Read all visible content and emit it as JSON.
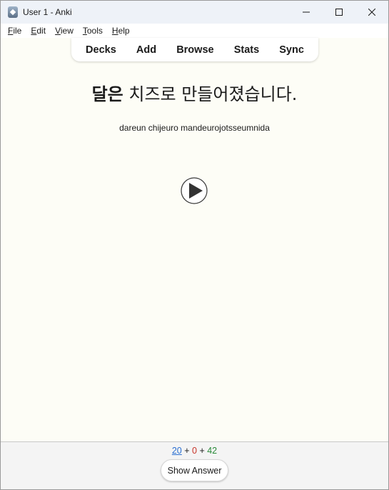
{
  "window": {
    "title": "User 1 - Anki",
    "app_icon": "anki-icon"
  },
  "menu": {
    "items": [
      {
        "label": "File",
        "mnemonic": "F",
        "rest": "ile"
      },
      {
        "label": "Edit",
        "mnemonic": "E",
        "rest": "dit"
      },
      {
        "label": "View",
        "mnemonic": "V",
        "rest": "iew"
      },
      {
        "label": "Tools",
        "mnemonic": "T",
        "rest": "ools"
      },
      {
        "label": "Help",
        "mnemonic": "H",
        "rest": "elp"
      }
    ]
  },
  "toolbar": {
    "decks": "Decks",
    "add": "Add",
    "browse": "Browse",
    "stats": "Stats",
    "sync": "Sync"
  },
  "card": {
    "sentence_bold": "달은",
    "sentence_rest": " 치즈로 만들어졌습니다.",
    "romanization": "dareun chijeuro mandeurojotsseumnida",
    "audio_icon": "play-icon"
  },
  "bottom": {
    "new_count": "20",
    "sep1": " + ",
    "learn_count": "0",
    "sep2": " + ",
    "review_count": "42",
    "show_answer": "Show Answer"
  },
  "colors": {
    "new": "#2b6fd1",
    "learn": "#c7352a",
    "review": "#2a8a3a",
    "card_background": "#fdfdf6"
  }
}
